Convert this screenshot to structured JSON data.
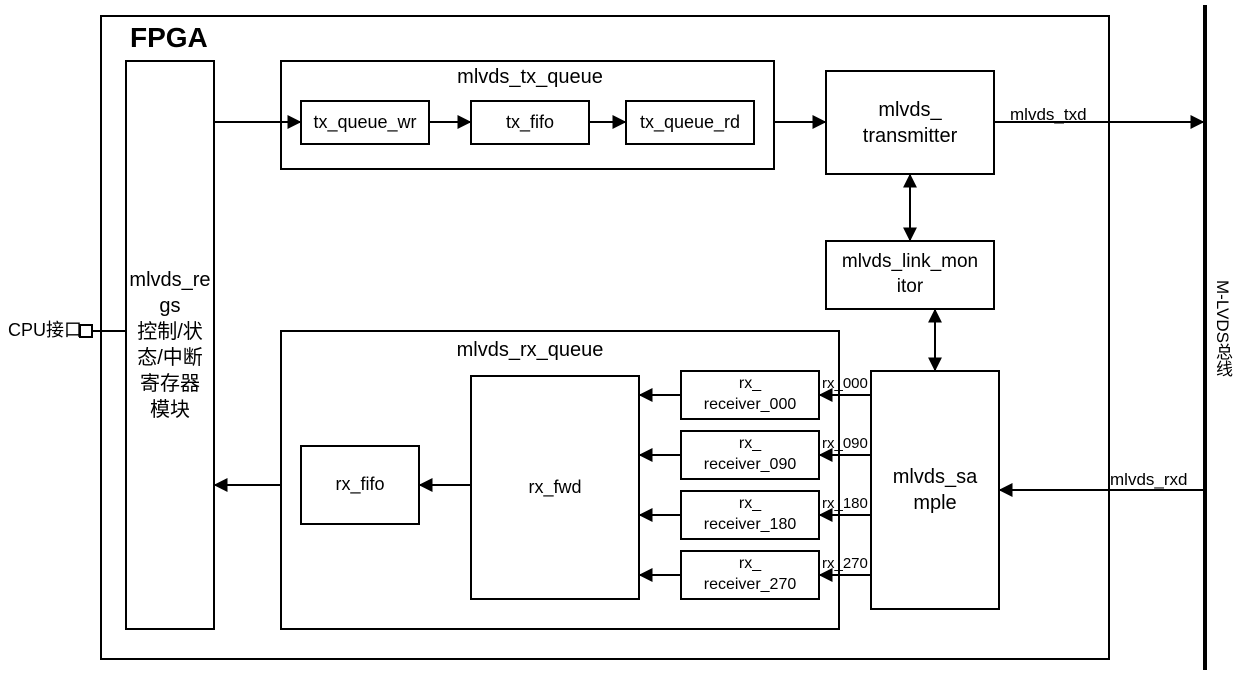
{
  "fpga_title": "FPGA",
  "cpu_label": "CPU接口",
  "mlvds_bus_label": "M-LVDS总线",
  "txd_label": "mlvds_txd",
  "rxd_label": "mlvds_rxd",
  "regs_block": "mlvds_re\ngs\n控制/状\n态/中断\n寄存器\n模块",
  "tx_queue_title": "mlvds_tx_queue",
  "tx_queue_wr": "tx_queue_wr",
  "tx_fifo": "tx_fifo",
  "tx_queue_rd": "tx_queue_rd",
  "transmitter": "mlvds_\ntransmitter",
  "link_monitor": "mlvds_link_mon\nitor",
  "sample": "mlvds_sa\nmple",
  "rx_queue_title": "mlvds_rx_queue",
  "rx_fifo": "rx_fifo",
  "rx_fwd": "rx_fwd",
  "rx_receiver_000": "rx_\nreceiver_000",
  "rx_receiver_090": "rx_\nreceiver_090",
  "rx_receiver_180": "rx_\nreceiver_180",
  "rx_receiver_270": "rx_\nreceiver_270",
  "rx_000": "rx_000",
  "rx_090": "rx_090",
  "rx_180": "rx_180",
  "rx_270": "rx_270"
}
